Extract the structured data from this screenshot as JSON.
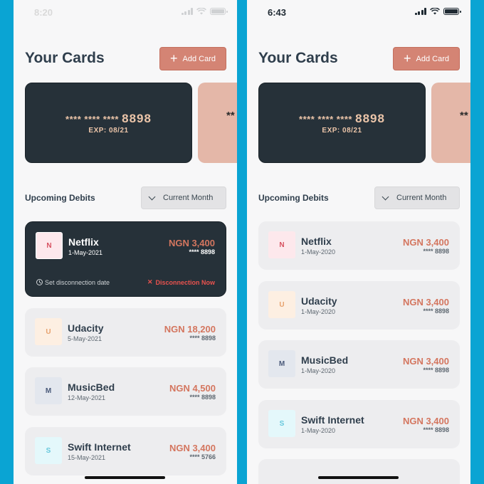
{
  "screens": [
    {
      "status_time": "8:20",
      "title": "Your Cards",
      "add_card_label": "Add Card",
      "card": {
        "number_masked": "**** **** ****",
        "last4": "8898",
        "expiry": "EXP: 08/21"
      },
      "peek_card_text": "**",
      "section_title": "Upcoming Debits",
      "filter_label": "Current Month",
      "debits": [
        {
          "initial": "N",
          "name": "Netflix",
          "date": "1-May-2021",
          "amount": "NGN 3,400",
          "card": "**** 8898",
          "set_date_label": "Set disconnection date",
          "disconnect_label": "Disconnection Now",
          "logo_bg": "#fde8ec",
          "logo_fg": "#d7505f"
        },
        {
          "initial": "U",
          "name": "Udacity",
          "date": "5-May-2021",
          "amount": "NGN 18,200",
          "card": "**** 8898",
          "logo_bg": "#fdefe2",
          "logo_fg": "#e7a26e"
        },
        {
          "initial": "M",
          "name": "MusicBed",
          "date": "12-May-2021",
          "amount": "NGN 4,500",
          "card": "**** 8898",
          "logo_bg": "#e3e7ee",
          "logo_fg": "#4a5a7a"
        },
        {
          "initial": "S",
          "name": "Swift Internet",
          "date": "15-May-2021",
          "amount": "NGN 3,400",
          "card": "**** 5766",
          "logo_bg": "#e4f8fb",
          "logo_fg": "#66c7dc"
        }
      ]
    },
    {
      "status_time": "6:43",
      "title": "Your Cards",
      "add_card_label": "Add Card",
      "card": {
        "number_masked": "**** **** ****",
        "last4": "8898",
        "expiry": "EXP: 08/21"
      },
      "peek_card_text": "**",
      "section_title": "Upcoming Debits",
      "filter_label": "Current Month",
      "debits": [
        {
          "initial": "N",
          "name": "Netflix",
          "date": "1-May-2020",
          "amount": "NGN 3,400",
          "card": "**** 8898",
          "logo_bg": "#fde8ec",
          "logo_fg": "#d7505f"
        },
        {
          "initial": "U",
          "name": "Udacity",
          "date": "1-May-2020",
          "amount": "NGN 3,400",
          "card": "**** 8898",
          "logo_bg": "#fdefe2",
          "logo_fg": "#e7a26e"
        },
        {
          "initial": "M",
          "name": "MusicBed",
          "date": "1-May-2020",
          "amount": "NGN 3,400",
          "card": "**** 8898",
          "logo_bg": "#e3e7ee",
          "logo_fg": "#4a5a7a"
        },
        {
          "initial": "S",
          "name": "Swift Internet",
          "date": "1-May-2020",
          "amount": "NGN 3,400",
          "card": "**** 8898",
          "logo_bg": "#e4f8fb",
          "logo_fg": "#66c7dc"
        }
      ]
    }
  ],
  "colors": {
    "accent": "#d48474",
    "card_dark": "#263139",
    "amount": "#d4765f",
    "danger": "#e9524e",
    "frame": "#0aa4d3"
  }
}
